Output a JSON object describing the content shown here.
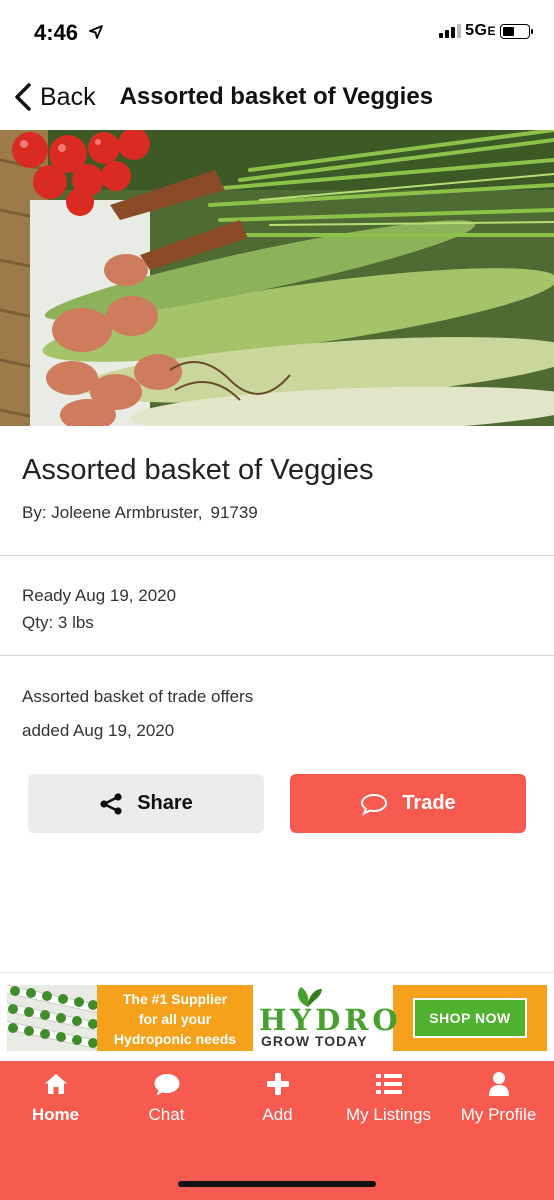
{
  "status_bar": {
    "time": "4:46",
    "network": "5G",
    "network_suffix": "E"
  },
  "nav": {
    "back_label": "Back",
    "title": "Assorted basket of Veggies"
  },
  "listing": {
    "title": "Assorted basket of Veggies",
    "by_label": "By: Joleene Armbruster,",
    "zip": "91739",
    "ready": "Ready Aug 19, 2020",
    "qty": "Qty: 3 lbs",
    "description": "Assorted basket of trade offers",
    "added": "added Aug 19, 2020"
  },
  "actions": {
    "share_label": "Share",
    "trade_label": "Trade"
  },
  "ad": {
    "line1": "The #1 Supplier",
    "line2": "for all your",
    "line3": "Hydroponic needs",
    "brand": "HYDRO",
    "tagline": "GROW TODAY",
    "cta": "SHOP NOW"
  },
  "tabs": [
    {
      "label": "Home",
      "icon": "home-icon",
      "active": true
    },
    {
      "label": "Chat",
      "icon": "chat-icon",
      "active": false
    },
    {
      "label": "Add",
      "icon": "plus-icon",
      "active": false
    },
    {
      "label": "My Listings",
      "icon": "list-icon",
      "active": false
    },
    {
      "label": "My Profile",
      "icon": "user-icon",
      "active": false
    }
  ],
  "colors": {
    "accent": "#f75a4f",
    "ad_orange": "#f5a11c",
    "ad_green": "#4fb22f"
  }
}
